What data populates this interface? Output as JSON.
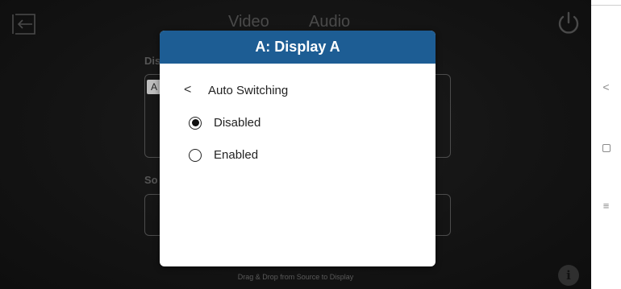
{
  "app": {
    "tabs": [
      "Video",
      "Audio"
    ],
    "displays_label": "Dis",
    "sources_label": "So",
    "display_chip": "A",
    "hint": "Drag & Drop from Source to Display",
    "info_icon": "i"
  },
  "modal": {
    "title": "A: Display A",
    "back_icon": "<",
    "subtitle": "Auto Switching",
    "options": [
      {
        "label": "Disabled",
        "selected": true
      },
      {
        "label": "Enabled",
        "selected": false
      }
    ]
  },
  "navbar": {
    "back_icon": "<",
    "recents_icon": "≡"
  },
  "colors": {
    "modal_header": "#1d5d94",
    "app_background": "#141414"
  }
}
